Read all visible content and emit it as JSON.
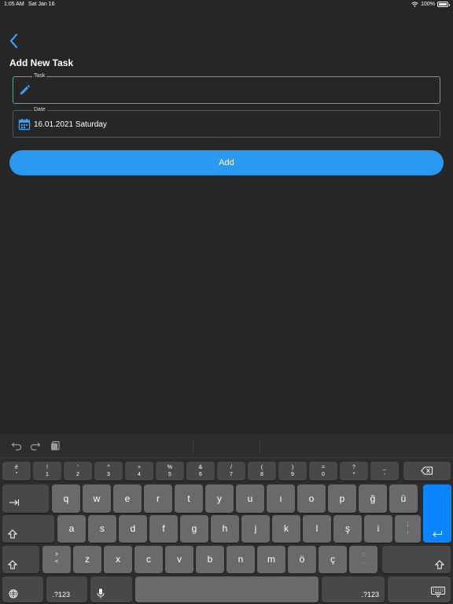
{
  "status": {
    "time": "1:05 AM",
    "date": "Sat Jan 16",
    "battery": "100%"
  },
  "page": {
    "title": "Add New Task"
  },
  "task_field": {
    "label": "Task",
    "value": "",
    "placeholder": ""
  },
  "date_field": {
    "label": "Date",
    "value": "16.01.2021 Saturday"
  },
  "add_button": {
    "label": "Add"
  },
  "colors": {
    "accent": "#2b99f0",
    "background": "#262626",
    "keyboard": "#2d2d2d"
  },
  "keyboard": {
    "toolbar": [
      "undo-icon",
      "redo-icon",
      "clipboard-icon"
    ],
    "number_row": [
      {
        "top": "é",
        "bottom": "\""
      },
      {
        "top": "!",
        "bottom": "1"
      },
      {
        "top": "'",
        "bottom": "2"
      },
      {
        "top": "^",
        "bottom": "3"
      },
      {
        "top": "+",
        "bottom": "4"
      },
      {
        "top": "%",
        "bottom": "5"
      },
      {
        "top": "&",
        "bottom": "6"
      },
      {
        "top": "/",
        "bottom": "7"
      },
      {
        "top": "(",
        "bottom": "8"
      },
      {
        "top": ")",
        "bottom": "9"
      },
      {
        "top": "=",
        "bottom": "0"
      },
      {
        "top": "?",
        "bottom": "*"
      },
      {
        "top": "_",
        "bottom": "-"
      }
    ],
    "row1": [
      "q",
      "w",
      "e",
      "r",
      "t",
      "y",
      "u",
      "ı",
      "o",
      "p",
      "ğ",
      "ü"
    ],
    "row2": [
      "a",
      "s",
      "d",
      "f",
      "g",
      "h",
      "j",
      "k",
      "l",
      "ş",
      "i"
    ],
    "row2_extra": {
      "top": ";",
      "bottom": ","
    },
    "row3_first": {
      "top": ">",
      "bottom": "<"
    },
    "row3": [
      "z",
      "x",
      "c",
      "v",
      "b",
      "n",
      "m",
      "ö",
      "ç"
    ],
    "row3_extra": {
      "top": ":",
      "bottom": "."
    },
    "mode_label": ".?123"
  }
}
